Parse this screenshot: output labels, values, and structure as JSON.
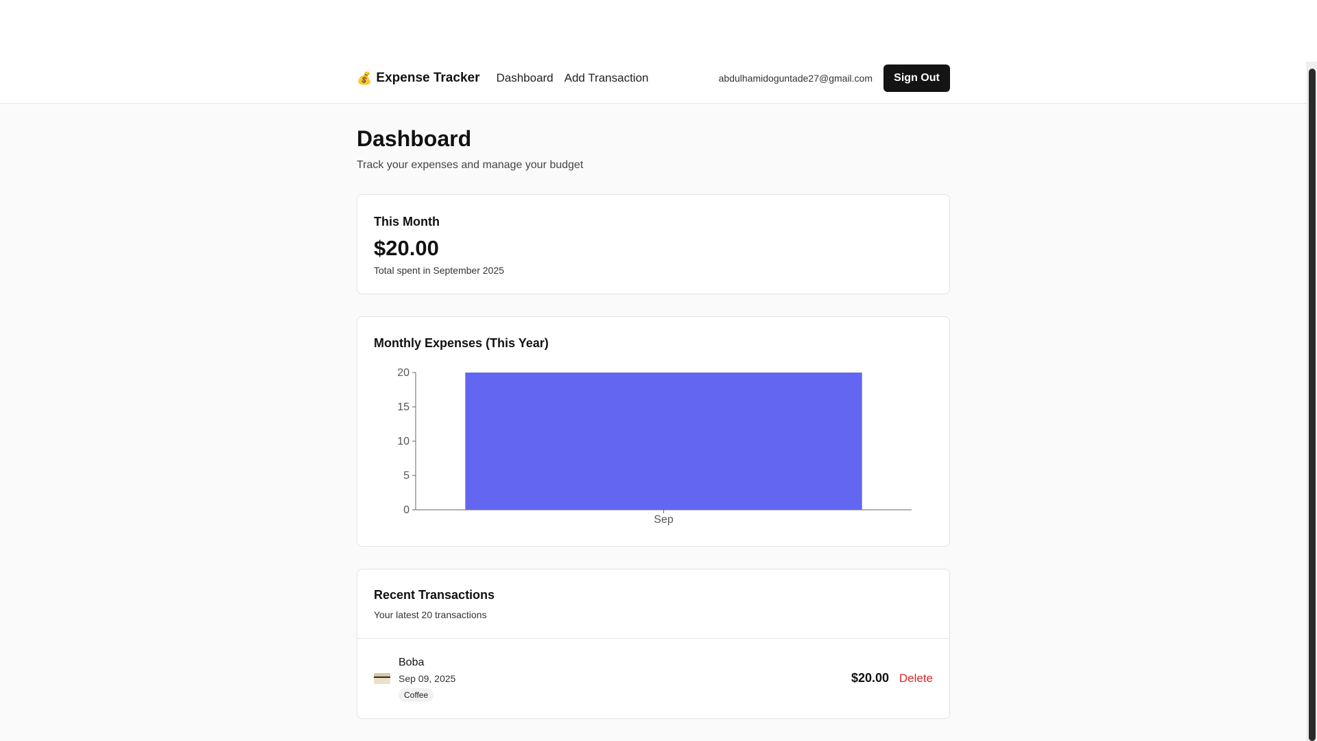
{
  "header": {
    "app_title": "Expense Tracker",
    "logo_icon": "money-bag-icon",
    "logo_glyph": "💰",
    "nav": [
      {
        "label": "Dashboard"
      },
      {
        "label": "Add Transaction"
      }
    ],
    "user_email": "abdulhamidoguntade27@gmail.com",
    "sign_out_label": "Sign Out"
  },
  "page": {
    "title": "Dashboard",
    "subtitle": "Track your expenses and manage your budget"
  },
  "summary": {
    "title": "This Month",
    "amount": "$20.00",
    "description": "Total spent in September 2025"
  },
  "chart_card": {
    "title": "Monthly Expenses (This Year)"
  },
  "chart_data": {
    "type": "bar",
    "title": "Monthly Expenses (This Year)",
    "categories": [
      "Sep"
    ],
    "values": [
      20
    ],
    "xlabel": "",
    "ylabel": "",
    "ylim": [
      0,
      20
    ],
    "yticks": [
      0,
      5,
      10,
      15,
      20
    ],
    "grid": false,
    "bar_color": "#6366f1"
  },
  "transactions": {
    "title": "Recent Transactions",
    "subtitle": "Your latest 20 transactions",
    "items": [
      {
        "name": "Boba",
        "date": "Sep 09, 2025",
        "category": "Coffee",
        "amount": "$20.00",
        "delete_label": "Delete",
        "icon": "credit-card-icon"
      }
    ]
  },
  "colors": {
    "accent": "#6366f1",
    "danger": "#dc2626",
    "primary_button": "#141414"
  }
}
